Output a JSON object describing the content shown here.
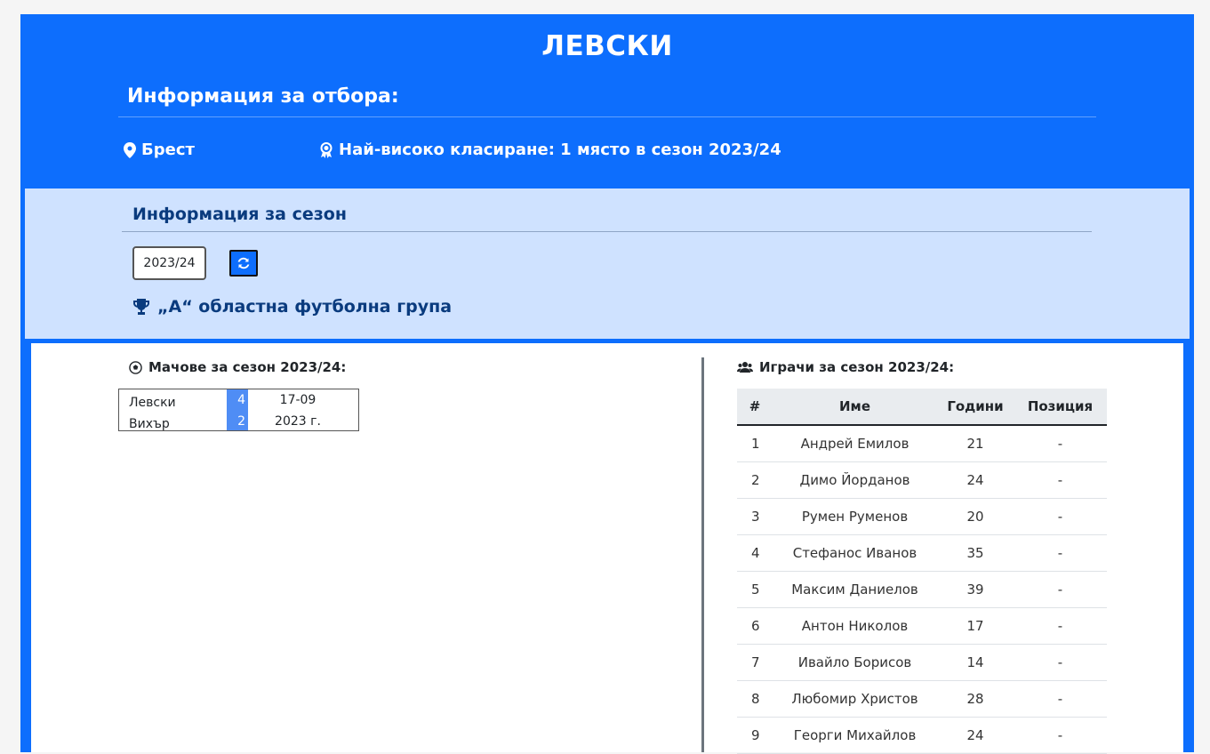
{
  "team": {
    "name": "ЛЕВСКИ",
    "info_heading": "Информация за отбора:",
    "city": "Брест",
    "best_ranking": "Най-високо класиране: 1 място в сезон 2023/24"
  },
  "season": {
    "heading": "Информация за сезон",
    "selected": "2023/24",
    "league": "„А“ областна футболна група"
  },
  "matches": {
    "title": "Мачове за сезон 2023/24:",
    "items": [
      {
        "home": "Левски",
        "away": "Вихър",
        "home_score": "4",
        "away_score": "2",
        "date": "17-09",
        "year": "2023 г."
      }
    ]
  },
  "players": {
    "title": "Играчи за сезон 2023/24:",
    "columns": [
      "#",
      "Име",
      "Години",
      "Позиция"
    ],
    "rows": [
      [
        "1",
        "Андрей Емилов",
        "21",
        "-"
      ],
      [
        "2",
        "Димо Йорданов",
        "24",
        "-"
      ],
      [
        "3",
        "Румен Руменов",
        "20",
        "-"
      ],
      [
        "4",
        "Стефанос Иванов",
        "35",
        "-"
      ],
      [
        "5",
        "Максим Даниелов",
        "39",
        "-"
      ],
      [
        "6",
        "Антон Николов",
        "17",
        "-"
      ],
      [
        "7",
        "Ивайло Борисов",
        "14",
        "-"
      ],
      [
        "8",
        "Любомир Христов",
        "28",
        "-"
      ],
      [
        "9",
        "Георги Михайлов",
        "24",
        "-"
      ]
    ]
  },
  "colors": {
    "primary": "#0d6efd",
    "panel": "#cfe2ff",
    "score_bg": "#4f8df5"
  },
  "icons": [
    "map-pin-icon",
    "award-icon",
    "refresh-icon",
    "trophy-icon",
    "soccer-ball-icon",
    "users-icon"
  ]
}
